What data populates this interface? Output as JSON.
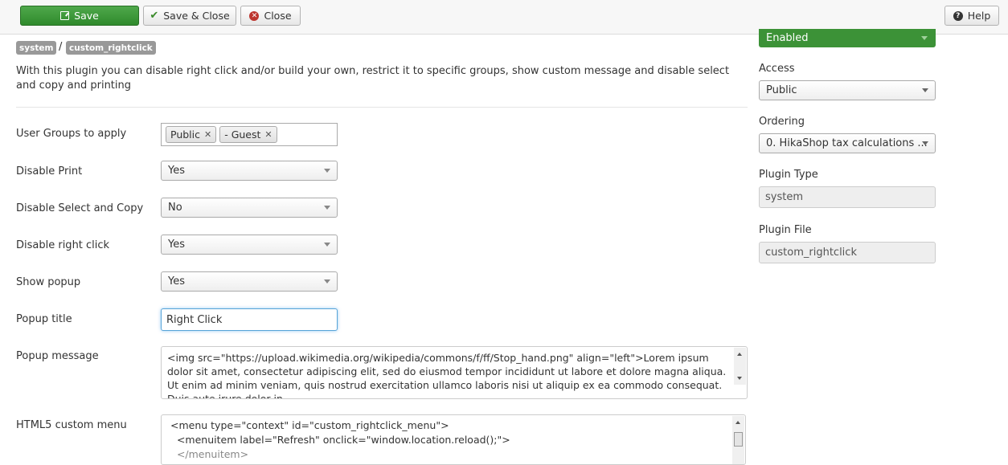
{
  "toolbar": {
    "save_label": "Save",
    "save_close_label": "Save & Close",
    "close_label": "Close",
    "help_label": "Help"
  },
  "header": {
    "folder_badge": "system",
    "separator": "/",
    "element_badge": "custom_rightclick",
    "description": "With this plugin you can disable right click and/or build your own, restrict it to specific groups, show custom message and disable select and copy and printing"
  },
  "form": {
    "user_groups": {
      "label": "User Groups to apply",
      "tags": [
        "Public",
        "- Guest"
      ]
    },
    "disable_print": {
      "label": "Disable Print",
      "value": "Yes"
    },
    "disable_select_copy": {
      "label": "Disable Select and Copy",
      "value": "No"
    },
    "disable_right_click": {
      "label": "Disable right click",
      "value": "Yes"
    },
    "show_popup": {
      "label": "Show popup",
      "value": "Yes"
    },
    "popup_title": {
      "label": "Popup title",
      "value": "Right Click"
    },
    "popup_message": {
      "label": "Popup message",
      "value": "<img src=\"https://upload.wikimedia.org/wikipedia/commons/f/ff/Stop_hand.png\" align=\"left\">Lorem ipsum dolor sit amet, consectetur adipiscing elit, sed do eiusmod tempor incididunt ut labore et dolore magna aliqua. Ut enim ad minim veniam, quis nostrud exercitation ullamco laboris nisi ut aliquip ex ea commodo consequat. Duis aute irure dolor in"
    },
    "html5_menu": {
      "label": "HTML5 custom menu",
      "lines": [
        "<menu type=\"context\" id=\"custom_rightclick_menu\">",
        "  <menuitem label=\"Refresh\" onclick=\"window.location.reload();\">",
        "  </menuitem>"
      ]
    }
  },
  "sidebar": {
    "status": "Enabled",
    "access": {
      "label": "Access",
      "value": "Public"
    },
    "ordering": {
      "label": "Ordering",
      "value": "0. HikaShop tax calculations ..."
    },
    "plugin_type": {
      "label": "Plugin Type",
      "value": "system"
    },
    "plugin_file": {
      "label": "Plugin File",
      "value": "custom_rightclick"
    }
  }
}
